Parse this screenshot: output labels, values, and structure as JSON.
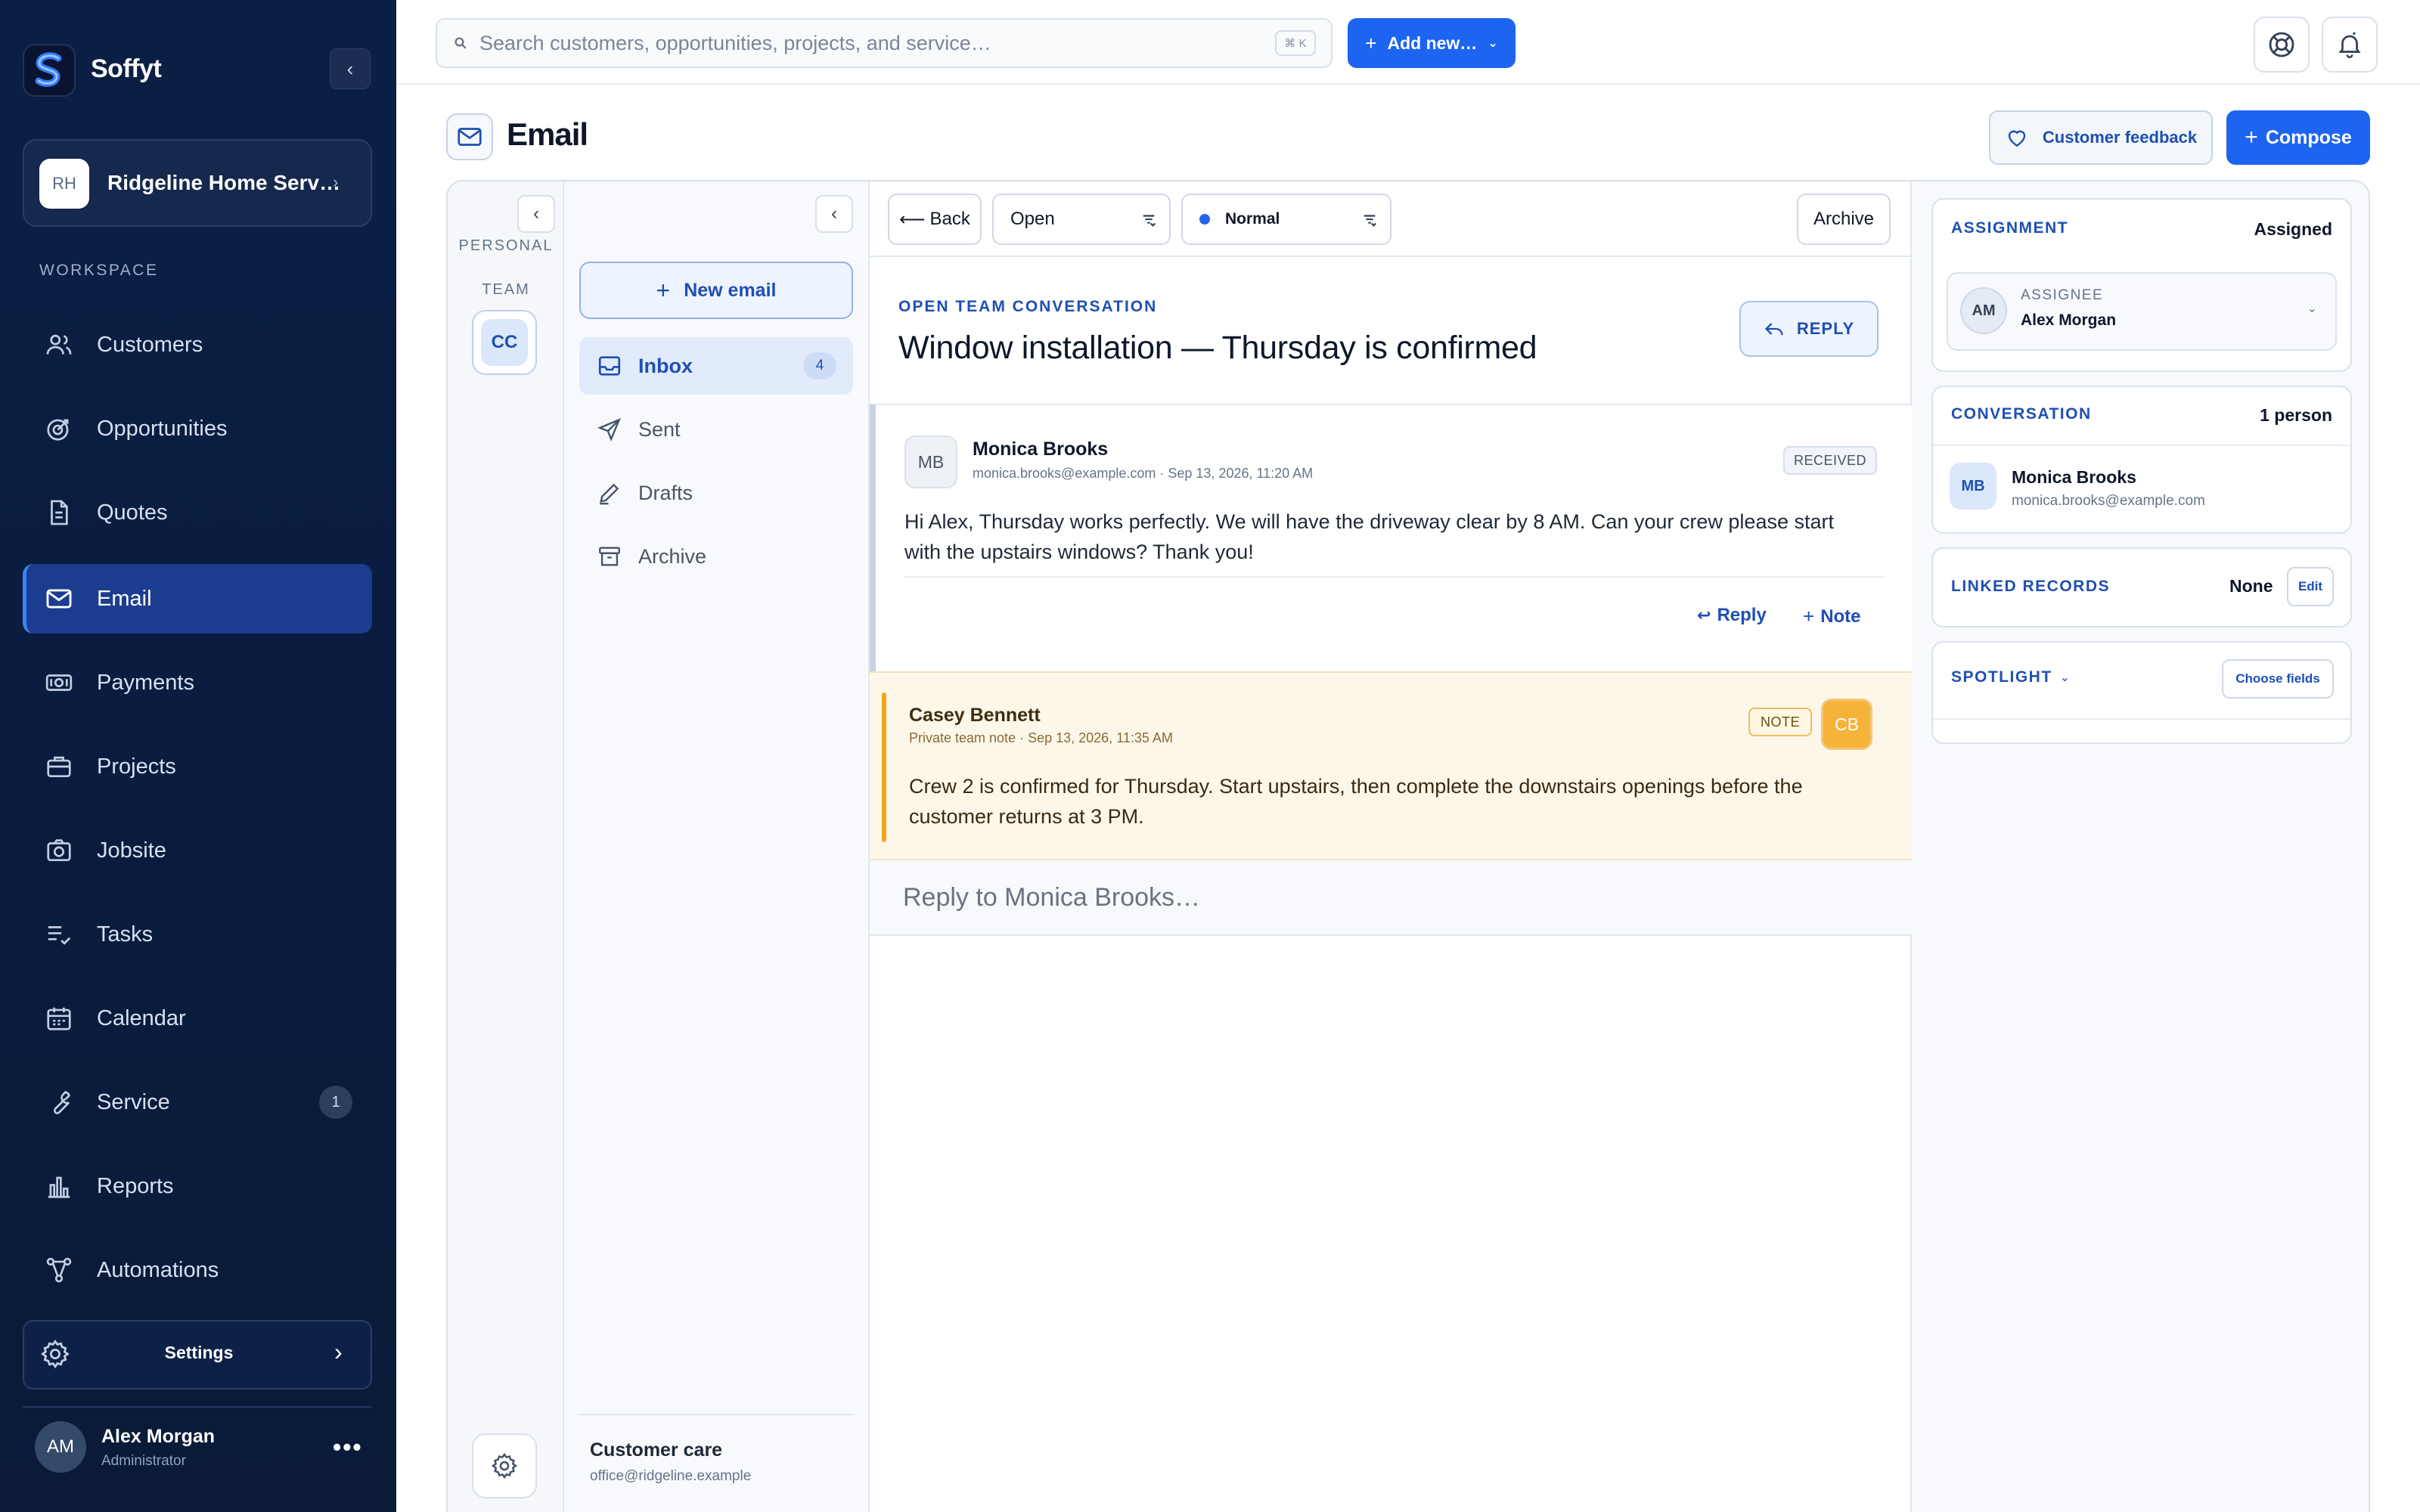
{
  "app": {
    "brand": "Soffyt"
  },
  "workspace": {
    "initials": "RH",
    "name": "Ridgeline Home Serv…",
    "section_label": "WORKSPACE"
  },
  "nav": {
    "items": [
      {
        "label": "Customers",
        "icon": "users-icon"
      },
      {
        "label": "Opportunities",
        "icon": "target-icon"
      },
      {
        "label": "Quotes",
        "icon": "document-icon"
      },
      {
        "label": "Email",
        "icon": "mail-icon",
        "active": true
      },
      {
        "label": "Payments",
        "icon": "cash-icon"
      },
      {
        "label": "Projects",
        "icon": "briefcase-icon"
      },
      {
        "label": "Jobsite",
        "icon": "camera-icon"
      },
      {
        "label": "Tasks",
        "icon": "checklist-icon"
      },
      {
        "label": "Calendar",
        "icon": "calendar-icon"
      },
      {
        "label": "Service",
        "icon": "wrench-icon",
        "badge": "1"
      },
      {
        "label": "Reports",
        "icon": "bar-chart-icon"
      },
      {
        "label": "Automations",
        "icon": "workflow-icon"
      }
    ],
    "settings_label": "Settings"
  },
  "user": {
    "initials": "AM",
    "name": "Alex Morgan",
    "role": "Administrator"
  },
  "topbar": {
    "search_placeholder": "Search customers, opportunities, projects, and service…",
    "shortcut": "⌘ K",
    "add_new_label": "Add new…"
  },
  "page": {
    "title": "Email",
    "feedback_label": "Customer feedback",
    "compose_label": "Compose"
  },
  "mailbox_rail": {
    "personal_label": "PERSONAL",
    "team_label": "TEAM",
    "team_initials": "CC"
  },
  "folders": {
    "new_email_label": "New email",
    "items": [
      {
        "label": "Inbox",
        "count": "4",
        "active": true
      },
      {
        "label": "Sent"
      },
      {
        "label": "Drafts"
      },
      {
        "label": "Archive"
      }
    ],
    "mailbox_name": "Customer care",
    "mailbox_email": "office@ridgeline.example"
  },
  "conversation": {
    "back_label": "Back",
    "status_value": "Open",
    "priority_value": "Normal",
    "archive_label": "Archive",
    "eyebrow": "OPEN TEAM CONVERSATION",
    "title": "Window installation — Thursday is confirmed",
    "reply_label": "REPLY",
    "message": {
      "initials": "MB",
      "from": "Monica Brooks",
      "meta": "monica.brooks@example.com · Sep 13, 2026, 11:20 AM",
      "tag": "RECEIVED",
      "body": "Hi Alex, Thursday works perfectly. We will have the driveway clear by 8 AM. Can your crew please start with the upstairs windows? Thank you!",
      "reply_action": "Reply",
      "note_action": "Note"
    },
    "note": {
      "initials": "CB",
      "from": "Casey Bennett",
      "meta": "Private team note · Sep 13, 2026, 11:35 AM",
      "tag": "NOTE",
      "body": "Crew 2 is confirmed for Thursday. Start upstairs, then complete the downstairs openings before the customer returns at 3 PM."
    },
    "reply_placeholder": "Reply to Monica Brooks…"
  },
  "details": {
    "assignment": {
      "title": "ASSIGNMENT",
      "status": "Assigned",
      "assignee_label": "ASSIGNEE",
      "assignee_initials": "AM",
      "assignee_name": "Alex Morgan"
    },
    "conversation": {
      "title": "CONVERSATION",
      "count": "1 person",
      "initials": "MB",
      "name": "Monica Brooks",
      "email": "monica.brooks@example.com"
    },
    "linked": {
      "title": "LINKED RECORDS",
      "value": "None",
      "edit_label": "Edit"
    },
    "spotlight": {
      "title": "SPOTLIGHT",
      "button_label": "Choose fields"
    }
  }
}
